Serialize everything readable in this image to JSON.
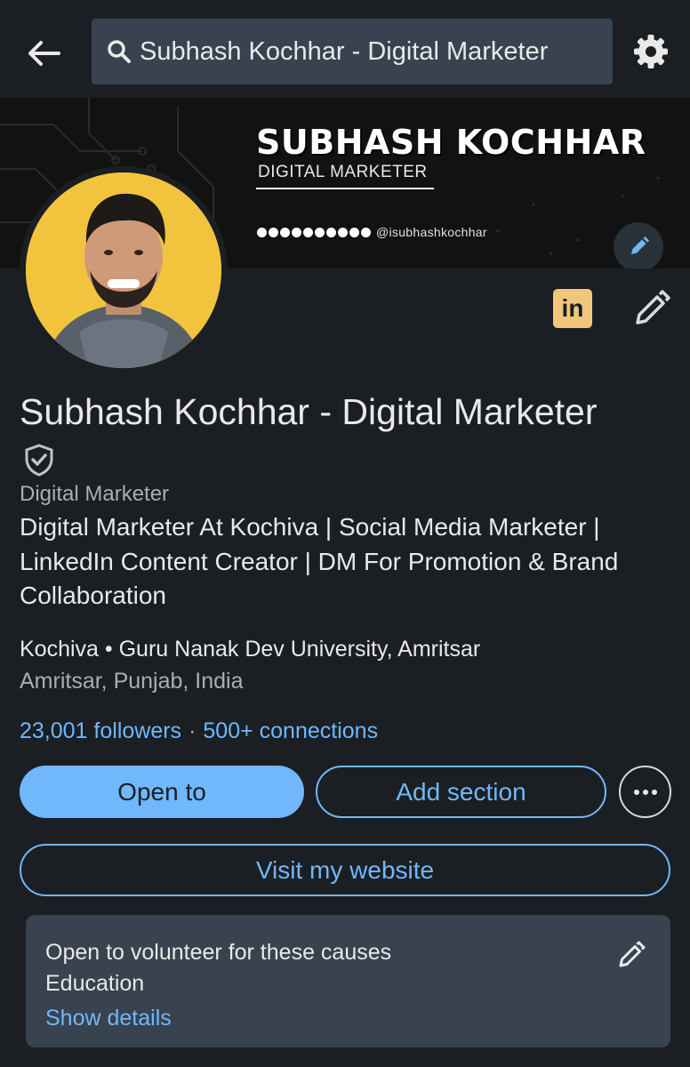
{
  "search": {
    "text": "Subhash Kochhar - Digital Marketer"
  },
  "banner": {
    "title": "SUBHASH KOCHHAR",
    "subtitle": "DIGITAL MARKETER",
    "handle": "@isubhashkochhar"
  },
  "profile": {
    "name": "Subhash Kochhar - Digital Marketer",
    "role": "Digital Marketer",
    "headline": "Digital Marketer At Kochiva | Social Media Marketer | LinkedIn Content Creator | DM For Promotion & Brand Collaboration",
    "company": "Kochiva",
    "education": "Guru Nanak Dev University, Amritsar",
    "location": "Amritsar, Punjab, India",
    "followers": "23,001 followers",
    "connections": "500+ connections",
    "linkedin_badge": "in"
  },
  "actions": {
    "open_to": "Open to",
    "add_section": "Add section",
    "visit_website": "Visit my website"
  },
  "volunteer": {
    "title": "Open to volunteer for these causes",
    "cause": "Education",
    "show_details": "Show details"
  },
  "colors": {
    "background": "#1b1f23",
    "accent": "#71b7fb",
    "card": "#38434f",
    "avatar_bg": "#f2c43d",
    "linkedin_badge": "#f0c77a"
  }
}
